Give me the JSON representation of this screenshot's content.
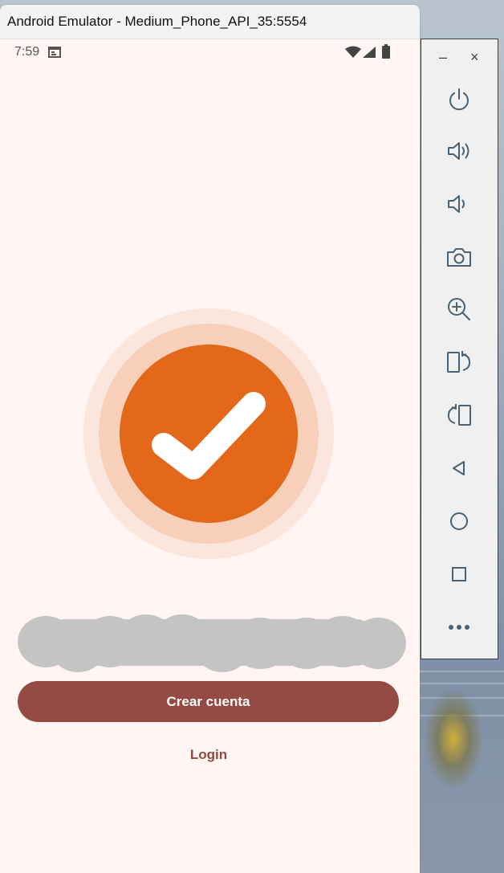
{
  "window": {
    "title": "Android Emulator - Medium_Phone_API_35:5554"
  },
  "statusbar": {
    "time": "7:59"
  },
  "app": {
    "primary_button": "Crear cuenta",
    "secondary_link": "Login",
    "colors": {
      "accent": "#e4681a",
      "button": "#954b43",
      "background": "#fff5f3"
    }
  },
  "emulator_toolbar": {
    "minimize": "–",
    "close": "×",
    "buttons": [
      "power-icon",
      "volume-up-icon",
      "volume-down-icon",
      "camera-icon",
      "zoom-in-icon",
      "rotate-left-icon",
      "rotate-right-icon",
      "back-icon",
      "home-icon",
      "overview-icon",
      "more-icon"
    ]
  }
}
